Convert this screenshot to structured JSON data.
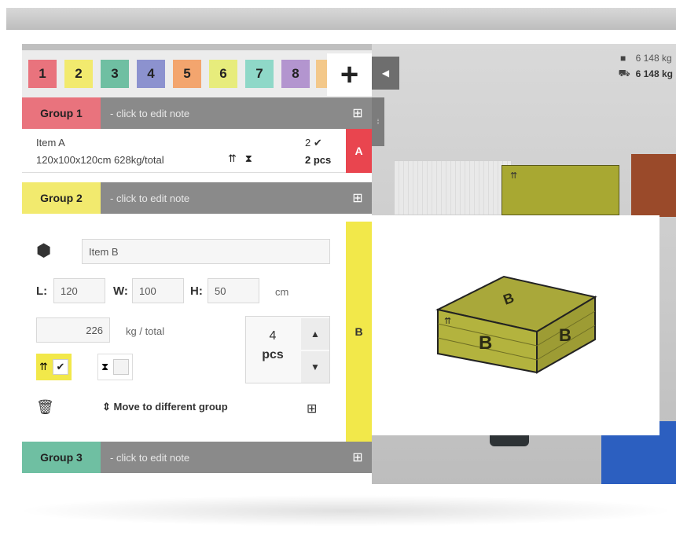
{
  "stats": {
    "weight_value": "6 148 kg",
    "load_value": "6 148 kg"
  },
  "tabs": [
    {
      "label": "1",
      "color": "#e9737d"
    },
    {
      "label": "2",
      "color": "#f2ea6e"
    },
    {
      "label": "3",
      "color": "#6fbfa2"
    },
    {
      "label": "4",
      "color": "#8c92cf"
    },
    {
      "label": "5",
      "color": "#f3a56e"
    },
    {
      "label": "6",
      "color": "#e7ec7c"
    },
    {
      "label": "7",
      "color": "#8fd8c8"
    },
    {
      "label": "8",
      "color": "#b395cf"
    }
  ],
  "add_label": "+",
  "note_placeholder": "- click to edit note",
  "groups": [
    {
      "label": "Group 1",
      "color": "#e9737d"
    },
    {
      "label": "Group 2",
      "color": "#f2ea6e"
    },
    {
      "label": "Group 3",
      "color": "#6fbfa2"
    }
  ],
  "item_a": {
    "name": "Item A",
    "dims": "120x100x120cm 628kg/total",
    "count": "2",
    "pcs": "2 pcs",
    "badge": "A"
  },
  "item_b": {
    "name": "Item B",
    "length_label": "L:",
    "length": "120",
    "width_label": "W:",
    "width": "100",
    "height_label": "H:",
    "height": "50",
    "unit": "cm",
    "weight": "226",
    "weight_unit": "kg / total",
    "qty": "4",
    "qty_unit": "pcs",
    "badge": "B",
    "move_label": "Move to different group",
    "box_letter": "B"
  }
}
